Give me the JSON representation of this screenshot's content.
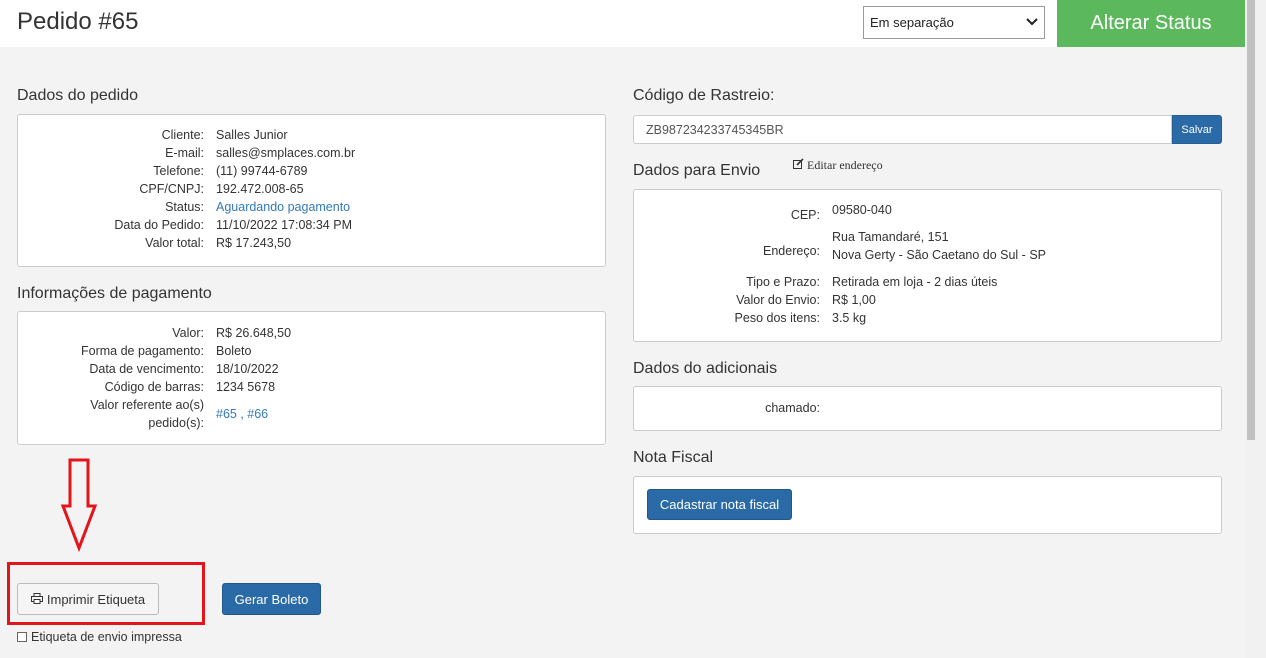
{
  "header": {
    "title": "Pedido #65",
    "status_selected": "Em separação",
    "alter_status_label": "Alterar Status"
  },
  "order_data": {
    "title": "Dados do pedido",
    "rows": [
      {
        "label": "Cliente:",
        "value": "Salles Junior"
      },
      {
        "label": "E-mail:",
        "value": "salles@smplaces.com.br"
      },
      {
        "label": "Telefone:",
        "value": "(11) 99744-6789"
      },
      {
        "label": "CPF/CNPJ:",
        "value": "192.472.008-65"
      },
      {
        "label": "Status:",
        "value": "Aguardando pagamento"
      },
      {
        "label": "Data do Pedido:",
        "value": "11/10/2022 17:08:34 PM"
      },
      {
        "label": "Valor total:",
        "value": "R$ 17.243,50"
      }
    ]
  },
  "payment_info": {
    "title": "Informações de pagamento",
    "rows": [
      {
        "label": "Valor:",
        "value": "R$ 26.648,50"
      },
      {
        "label": "Forma de pagamento:",
        "value": "Boleto"
      },
      {
        "label": "Data de vencimento:",
        "value": "18/10/2022"
      },
      {
        "label": "Código de barras:",
        "value": "1234 5678"
      }
    ],
    "ref_label_line1": "Valor referente ao(s)",
    "ref_label_line2": "pedido(s):",
    "ref_value": "#65 , #66"
  },
  "tracking": {
    "title": "Código de Rastreio:",
    "value": "ZB987234233745345BR",
    "save_label": "Salvar"
  },
  "shipping": {
    "title": "Dados para Envio",
    "edit_label": "Editar endereço",
    "cep_label": "CEP:",
    "cep_value": "09580-040",
    "address_label": "Endereço:",
    "address_line1": "Rua Tamandaré, 151",
    "address_line2": "Nova Gerty - São Caetano do Sul - SP",
    "type_label": "Tipo e Prazo:",
    "type_value": "Retirada em loja - 2 dias úteis",
    "shipping_value_label": "Valor do Envio:",
    "shipping_value": "R$ 1,00",
    "weight_label": "Peso dos itens:",
    "weight_value": "3.5 kg"
  },
  "additional": {
    "title": "Dados do adicionais",
    "label": "chamado:",
    "value": ""
  },
  "invoice": {
    "title": "Nota Fiscal",
    "button_label": "Cadastrar nota fiscal"
  },
  "actions": {
    "print_label": "Imprimir Etiqueta",
    "boleto_label": "Gerar Boleto",
    "printed_checkbox_label": "Etiqueta de envio impressa"
  },
  "colors": {
    "accent_green": "#5cb85c",
    "primary_blue": "#2a6aa6",
    "link_blue": "#337ab7",
    "annotation_red": "#e4141b"
  }
}
